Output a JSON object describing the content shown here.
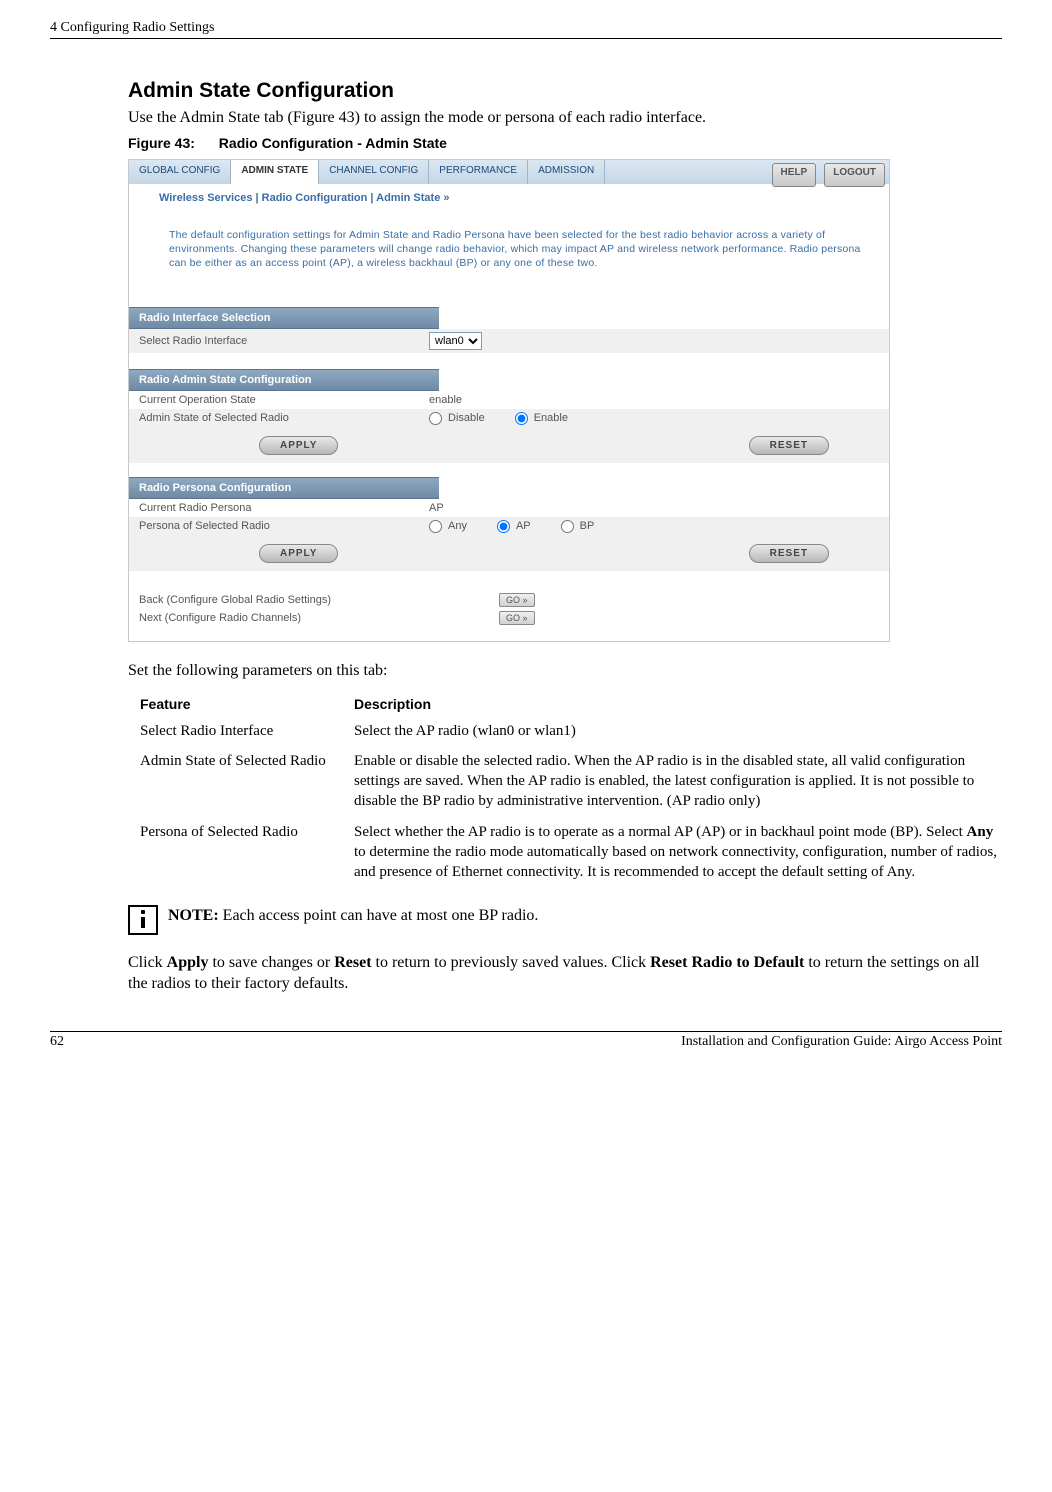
{
  "header": {
    "chapter": "4  Configuring Radio Settings"
  },
  "section": {
    "title": "Admin State Configuration",
    "intro": "Use the Admin State tab (Figure 43) to assign the mode or persona of each radio interface.",
    "figcap_num": "Figure 43:",
    "figcap_title": "Radio Configuration - Admin State"
  },
  "screenshot": {
    "tabs": {
      "global": "GLOBAL CONFIG",
      "admin": "ADMIN STATE",
      "channel": "CHANNEL CONFIG",
      "performance": "PERFORMANCE",
      "admission": "ADMISSION"
    },
    "buttons": {
      "help": "HELP",
      "logout": "LOGOUT",
      "apply": "APPLY",
      "reset": "RESET",
      "go": "GO »"
    },
    "breadcrumb": "Wireless Services | Radio Configuration | Admin State  »",
    "description": "The default configuration settings for Admin State and Radio Persona have been selected for the best radio behavior across a variety of environments. Changing these parameters will change radio behavior, which may impact AP and wireless network performance. Radio persona can be either as an access point (AP), a wireless backhaul (BP) or any one of these two.",
    "sections": {
      "interface": {
        "title": "Radio Interface Selection",
        "label": "Select Radio Interface",
        "value": "wlan0"
      },
      "adminstate": {
        "title": "Radio Admin State Configuration",
        "current_label": "Current Operation State",
        "current_value": "enable",
        "state_label": "Admin State of Selected Radio",
        "disable": "Disable",
        "enable": "Enable"
      },
      "persona": {
        "title": "Radio Persona Configuration",
        "current_label": "Current Radio Persona",
        "current_value": "AP",
        "persona_label": "Persona of Selected Radio",
        "any": "Any",
        "ap": "AP",
        "bp": "BP"
      },
      "nav": {
        "back": "Back (Configure Global Radio Settings)",
        "next": "Next (Configure Radio Channels)"
      }
    }
  },
  "params": {
    "intro": "Set the following parameters on this tab:",
    "th_feature": "Feature",
    "th_desc": "Description",
    "rows": [
      {
        "feature": "Select Radio Interface",
        "desc": "Select the AP radio (wlan0 or wlan1)"
      },
      {
        "feature": "Admin State of Selected Radio",
        "desc": "Enable or disable the selected radio. When the AP radio is in the disabled state, all valid configuration settings are saved. When the AP radio is enabled, the latest configuration is applied. It is not possible to disable the BP radio by administrative intervention. (AP radio only)"
      },
      {
        "feature": "Persona of Selected Radio",
        "desc_pre": "Select whether the AP radio is to operate as a normal AP (AP) or in backhaul point mode (BP). Select ",
        "desc_bold": "Any",
        "desc_post": " to determine the radio mode automatically based on network connectivity, configuration, number of radios, and presence of Ethernet connectivity. It is recommended to accept the default setting of Any."
      }
    ]
  },
  "note": {
    "label": "NOTE:",
    "text": " Each access point can have at most one BP radio."
  },
  "apply": {
    "pre": "Click ",
    "b1": "Apply",
    "mid1": " to save changes or ",
    "b2": "Reset",
    "mid2": " to return to previously saved values. Click ",
    "b3": "Reset Radio to Default",
    "post": " to return the settings on all the radios to their factory defaults."
  },
  "footer": {
    "page": "62",
    "title": "Installation and Configuration Guide: Airgo Access Point"
  }
}
